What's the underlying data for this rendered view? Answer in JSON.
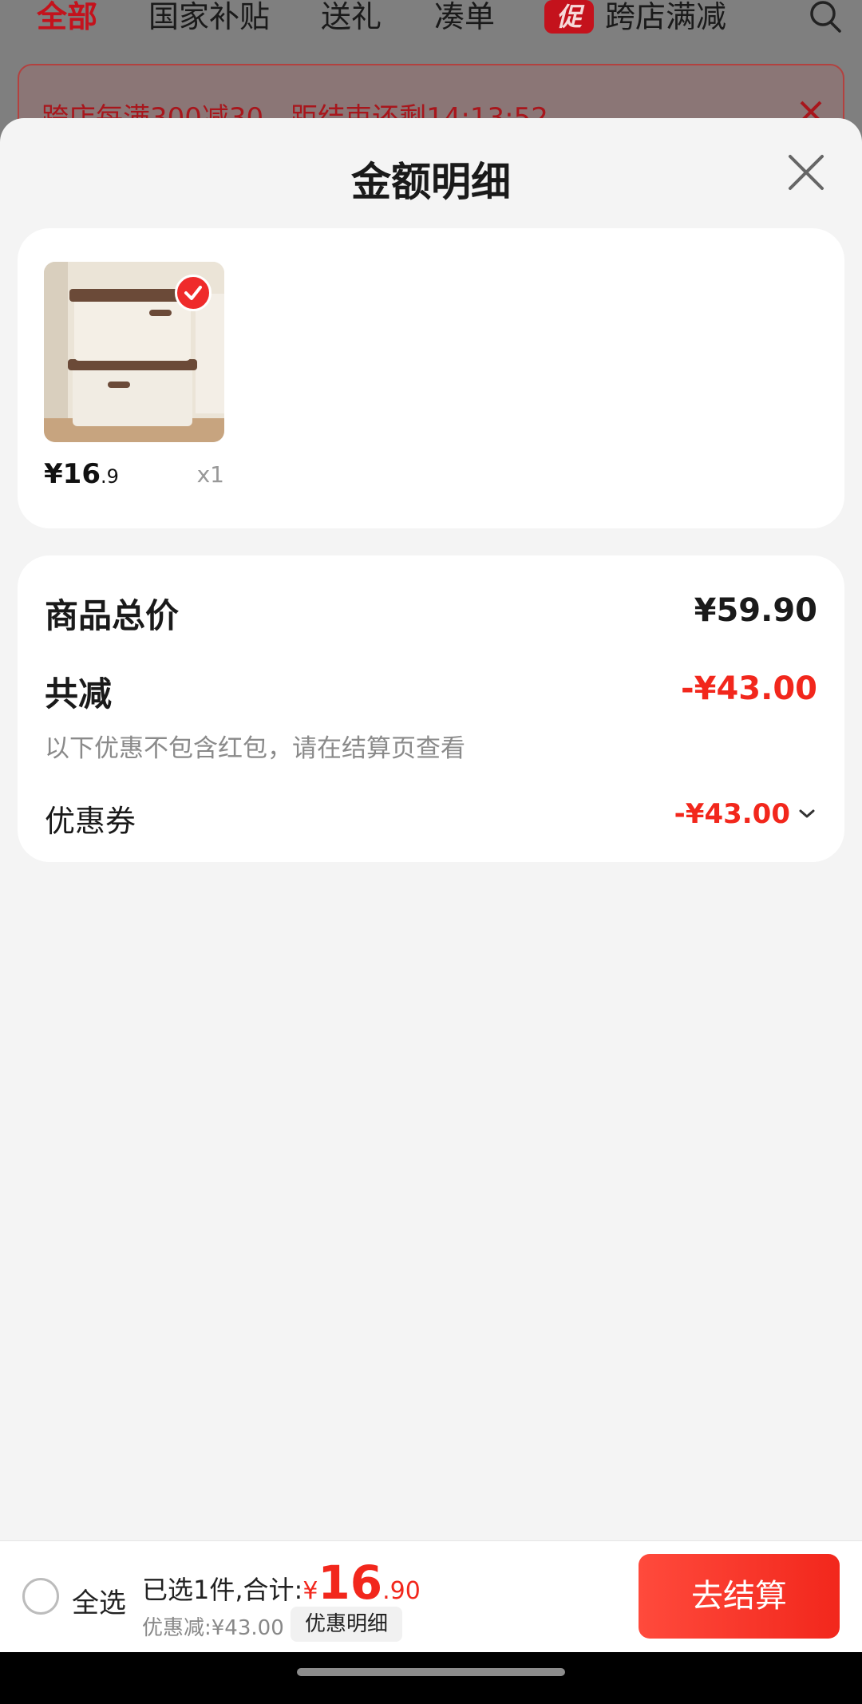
{
  "tabs": [
    {
      "label": "全部"
    },
    {
      "label": "国家补贴"
    },
    {
      "label": "送礼"
    },
    {
      "label": "凑单"
    },
    {
      "label": "跨店满减",
      "badge": "促"
    }
  ],
  "banner": {
    "text": "跨店每满300减30，距结束还剩14:13:52"
  },
  "sheet": {
    "title": "金额明细"
  },
  "item": {
    "price_main": "¥16",
    "price_decimal": ".9",
    "quantity": "x1"
  },
  "summary": {
    "total_label": "商品总价",
    "total_value": "¥59.90",
    "reduce_label": "共减",
    "reduce_value": "-¥43.00",
    "note": "以下优惠不包含红包，请在结算页查看",
    "coupon_label": "优惠券",
    "coupon_value": "-¥43.00"
  },
  "bottom": {
    "select_all": "全选",
    "selected_text": "已选1件,合计:",
    "currency": "¥",
    "amount_int": "16",
    "amount_dec": ".90",
    "discount_text": "优惠减:¥43.00",
    "detail_button": "优惠明细",
    "checkout_button": "去结算"
  },
  "colors": {
    "accent": "#f2271c",
    "dark_red": "#c4121c",
    "sheet_bg": "#f4f4f4"
  }
}
